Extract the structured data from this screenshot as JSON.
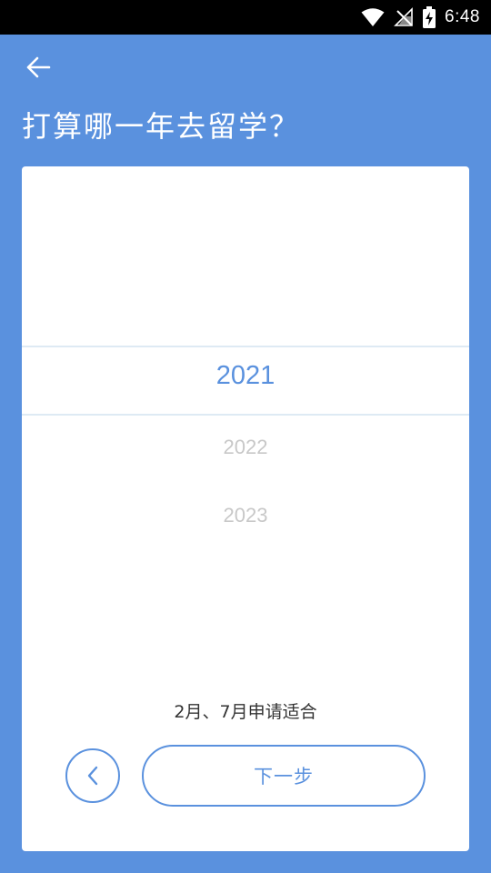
{
  "status_bar": {
    "time": "6:48",
    "icons": [
      "wifi-icon",
      "no-signal-icon",
      "battery-charging-icon"
    ]
  },
  "header": {
    "back_icon": "arrow-left-icon",
    "title": "打算哪一年去留学？"
  },
  "picker": {
    "selected": "2021",
    "options": [
      "2021",
      "2022",
      "2023"
    ]
  },
  "hint": "2月、7月申请适合",
  "actions": {
    "prev_icon": "chevron-left-icon",
    "next_label": "下一步"
  },
  "colors": {
    "background": "#5a91de",
    "accent": "#5a91de",
    "card": "#ffffff",
    "status_bar": "#000000",
    "faded_text": "#c8c8c8"
  }
}
